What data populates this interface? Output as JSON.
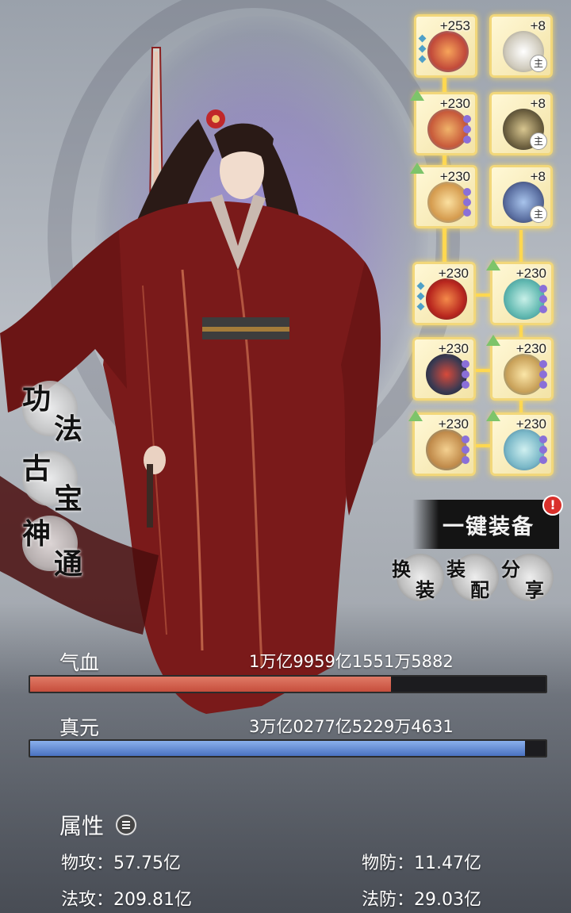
{
  "left_menu": [
    {
      "c1": "功",
      "c2": "法"
    },
    {
      "c1": "古",
      "c2": "宝"
    },
    {
      "c1": "神",
      "c2": "通"
    }
  ],
  "equipment": {
    "right_column": [
      {
        "level": "+8",
        "tag": "主",
        "icon": "scroll-icon"
      },
      {
        "level": "+8",
        "tag": "主",
        "icon": "dagger-icon"
      },
      {
        "level": "+8",
        "tag": "主",
        "icon": "blade-icon"
      }
    ],
    "left_column": [
      {
        "level": "+253",
        "icon": "flame-lotus-icon"
      },
      {
        "level": "+230",
        "icon": "phoenix-crown-icon"
      },
      {
        "level": "+230",
        "icon": "gold-ring-icon"
      }
    ],
    "grid": [
      {
        "level": "+230",
        "icon": "fire-feather-icon"
      },
      {
        "level": "+230",
        "icon": "jade-wing-icon"
      },
      {
        "level": "+230",
        "icon": "armor-icon"
      },
      {
        "level": "+230",
        "icon": "golden-mirror-icon"
      },
      {
        "level": "+230",
        "icon": "bronze-disc-icon"
      },
      {
        "level": "+230",
        "icon": "spirit-lamp-icon"
      }
    ]
  },
  "actions": {
    "one_key_equip": "一键装备",
    "alert": "!",
    "switch": {
      "a": "换",
      "b": "装"
    },
    "assemble": {
      "a": "装",
      "b": "配"
    },
    "share": {
      "a": "分",
      "b": "享"
    }
  },
  "stats": {
    "hp_label": "气血",
    "hp_value": "1万亿9959亿1551万5882",
    "hp_fill": 0.7,
    "mp_label": "真元",
    "mp_value": "3万亿0277亿5229万4631",
    "mp_fill": 0.96
  },
  "attributes": {
    "title": "属性",
    "phys_atk_label": "物攻：",
    "phys_atk": "57.75亿",
    "phys_def_label": "物防：",
    "phys_def": "11.47亿",
    "mag_atk_label": "法攻：",
    "mag_atk": "209.81亿",
    "mag_def_label": "法防：",
    "mag_def": "29.03亿"
  }
}
